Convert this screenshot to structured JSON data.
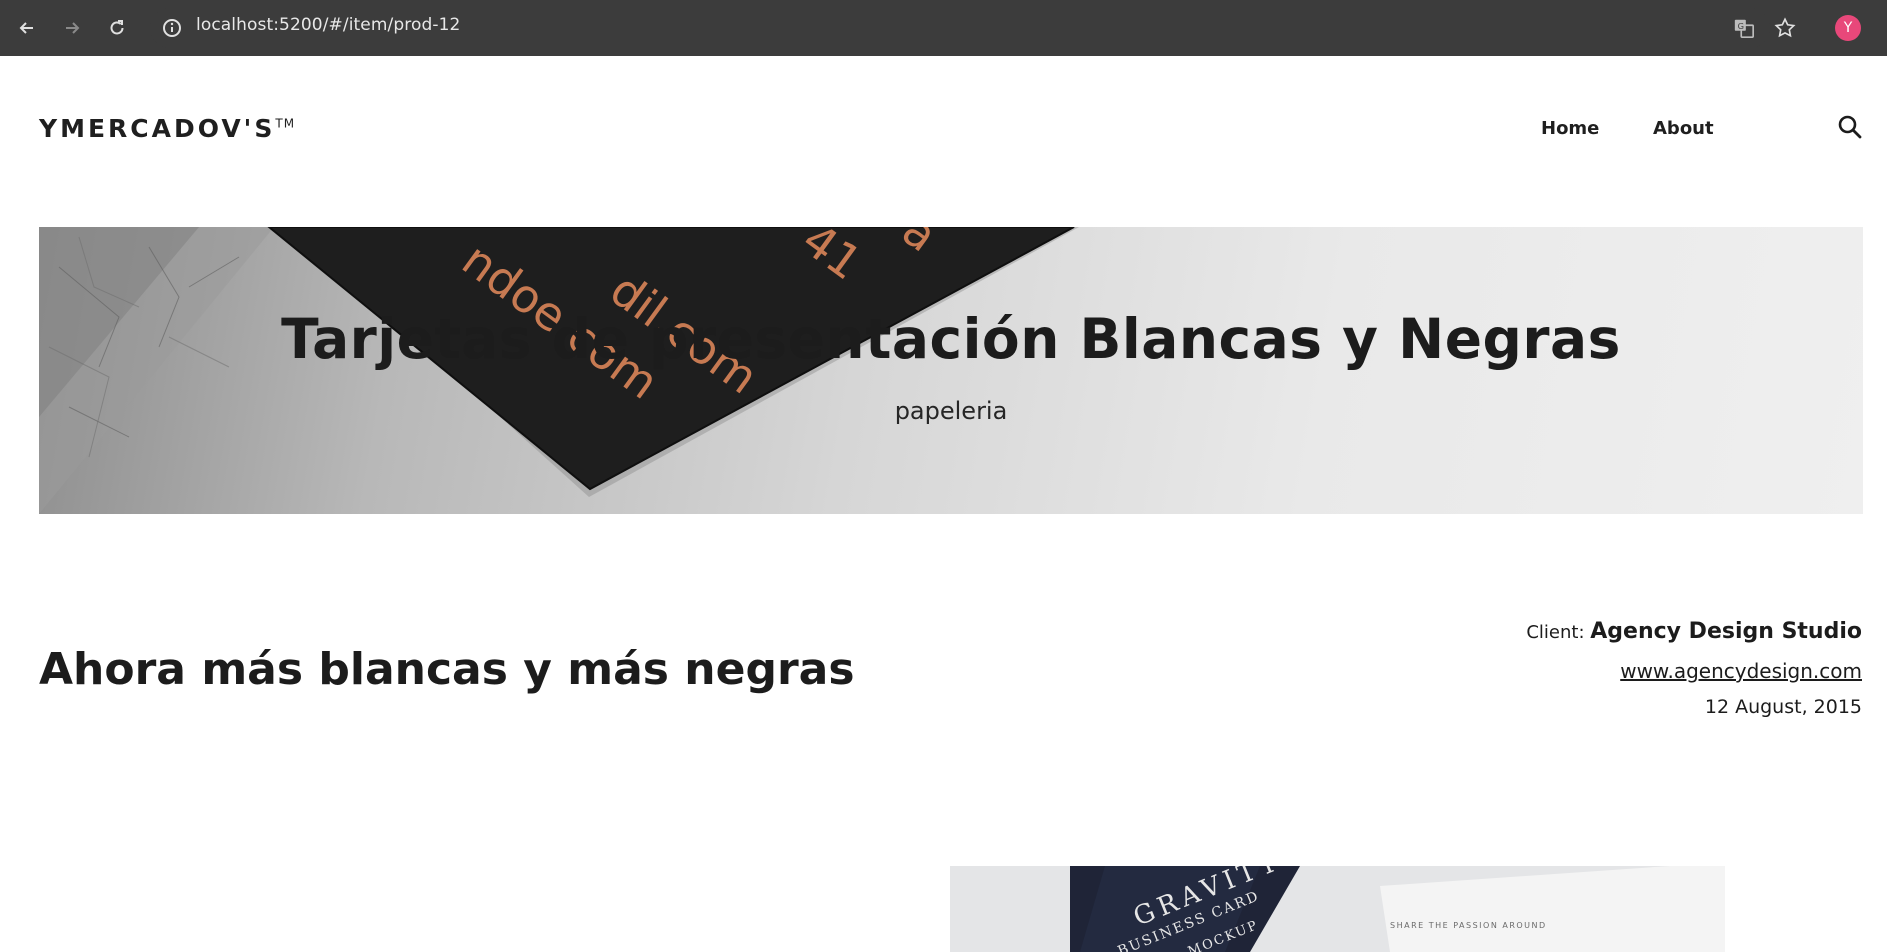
{
  "browser": {
    "url": "localhost:5200/#/item/prod-12",
    "profile_initial": "Y",
    "icons": [
      "back-arrow-icon",
      "forward-arrow-icon",
      "reload-icon",
      "info-icon",
      "translate-icon",
      "star-icon"
    ]
  },
  "site": {
    "brand": "YMERCADOV'S",
    "brand_tm": "TM",
    "nav": {
      "home": "Home",
      "about": "About"
    }
  },
  "hero": {
    "title": "Tarjetas de presentación Blancas y Negras",
    "subtitle": "papeleria",
    "card_text": [
      "dil.com",
      "ndoe.com",
      "41"
    ]
  },
  "content": {
    "headline": "Ahora más blancas y más negras",
    "client_label": "Client:",
    "client_name": "Agency Design Studio",
    "client_url": "www.agencydesign.com",
    "date": "12 August, 2015"
  },
  "preview": {
    "card_text": [
      "GRAVITY",
      "BUSINESS CARD",
      "MOCKUP",
      "SHARE THE PASSION AROUND"
    ]
  },
  "colors": {
    "chrome_bg": "#3c3c3c",
    "avatar": "#e8487a",
    "card_accent": "#c77a52",
    "text": "#1c1c1c"
  }
}
